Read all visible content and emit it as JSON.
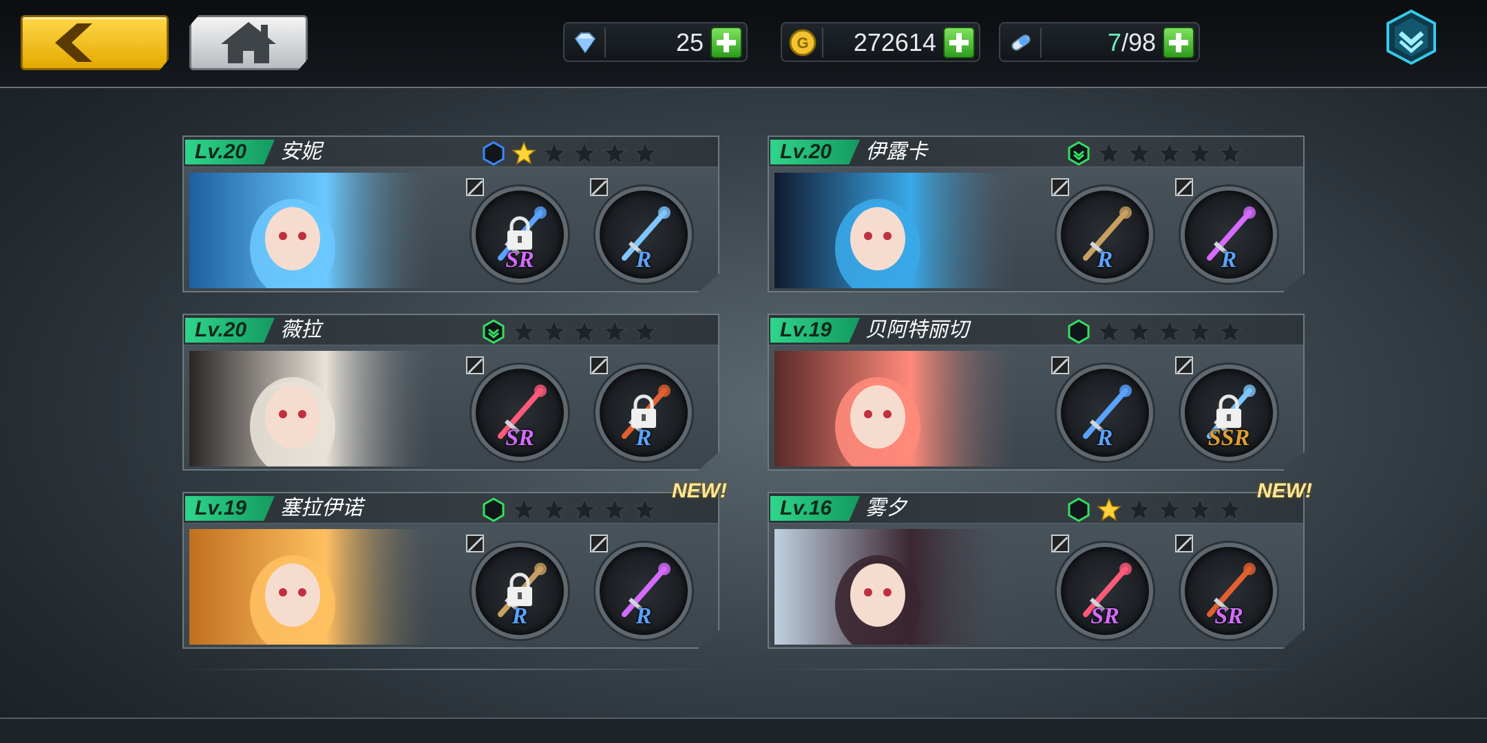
{
  "header": {
    "back_icon": "back-arrow-icon",
    "home_icon": "home-icon",
    "diamonds": "25",
    "gold": "272614",
    "stamina_current": "7",
    "stamina_separator": "/98",
    "menu_icon": "chevron-down-menu-icon"
  },
  "colors": {
    "accent_gold": "#e4a900",
    "level_green": "#2fd58a",
    "rank_blue": "#3a88ff",
    "rank_green": "#33e060",
    "star_gold": "#ffd23a"
  },
  "cards": [
    {
      "level": "Lv.20",
      "name": "安妮",
      "rank": "blue",
      "stars": 1,
      "new": "",
      "slots": [
        {
          "rarity": "SR",
          "locked": true
        },
        {
          "rarity": "R",
          "locked": false
        }
      ]
    },
    {
      "level": "Lv.20",
      "name": "伊露卡",
      "rank": "green-up",
      "stars": 0,
      "new": "",
      "slots": [
        {
          "rarity": "R",
          "locked": false
        },
        {
          "rarity": "R",
          "locked": false
        }
      ]
    },
    {
      "level": "Lv.20",
      "name": "薇拉",
      "rank": "green-up",
      "stars": 0,
      "new": "",
      "slots": [
        {
          "rarity": "SR",
          "locked": false
        },
        {
          "rarity": "R",
          "locked": true
        }
      ]
    },
    {
      "level": "Lv.19",
      "name": "贝阿特丽切",
      "rank": "green",
      "stars": 0,
      "new": "",
      "slots": [
        {
          "rarity": "R",
          "locked": false
        },
        {
          "rarity": "SSR",
          "locked": true
        }
      ]
    },
    {
      "level": "Lv.19",
      "name": "塞拉伊诺",
      "rank": "green",
      "stars": 0,
      "new": "NEW!",
      "slots": [
        {
          "rarity": "R",
          "locked": true
        },
        {
          "rarity": "R",
          "locked": false
        }
      ]
    },
    {
      "level": "Lv.16",
      "name": "雾夕",
      "rank": "green",
      "stars": 1,
      "new": "NEW!",
      "slots": [
        {
          "rarity": "SR",
          "locked": false
        },
        {
          "rarity": "SR",
          "locked": false
        }
      ]
    }
  ]
}
